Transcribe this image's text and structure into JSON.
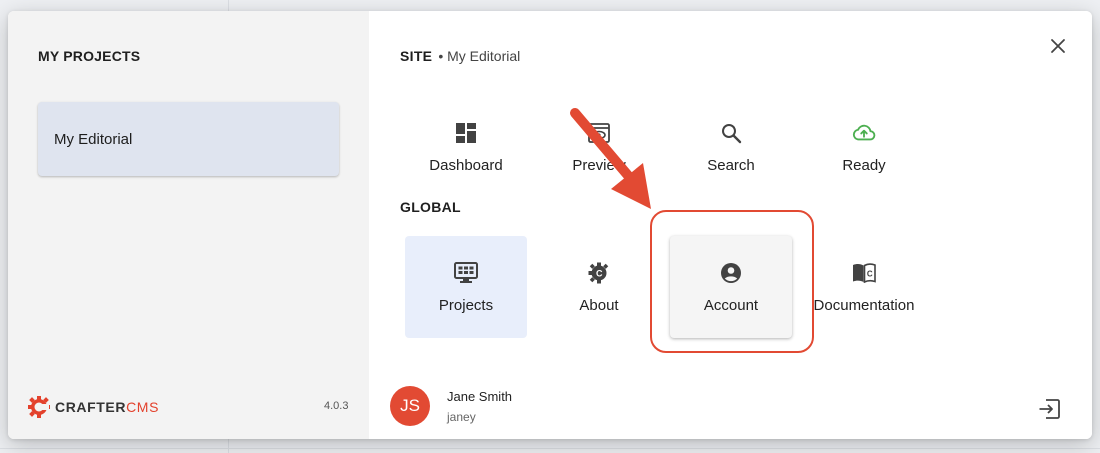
{
  "sidebar": {
    "title": "MY PROJECTS",
    "projects": [
      {
        "label": "My Editorial"
      }
    ],
    "brand": {
      "left": "CRAFTER",
      "right": "CMS"
    },
    "version": "4.0.3"
  },
  "site": {
    "heading": "SITE",
    "subtitle": "• My Editorial",
    "tiles": [
      {
        "label": "Dashboard",
        "icon": "dashboard-icon"
      },
      {
        "label": "Preview",
        "icon": "preview-icon"
      },
      {
        "label": "Search",
        "icon": "search-icon"
      },
      {
        "label": "Ready",
        "icon": "cloud-upload-icon",
        "color": "#4caf50"
      }
    ]
  },
  "global": {
    "heading": "GLOBAL",
    "tiles": [
      {
        "label": "Projects",
        "icon": "projects-icon"
      },
      {
        "label": "About",
        "icon": "crafter-gear-icon"
      },
      {
        "label": "Account",
        "icon": "account-circle-icon"
      },
      {
        "label": "Documentation",
        "icon": "book-icon"
      }
    ]
  },
  "user": {
    "initials": "JS",
    "name": "Jane Smith",
    "username": "janey"
  },
  "colors": {
    "accent": "#e24a33",
    "ready_green": "#4caf50",
    "selected_tile": "#e8eefb",
    "project_card": "#dfe4ef"
  }
}
